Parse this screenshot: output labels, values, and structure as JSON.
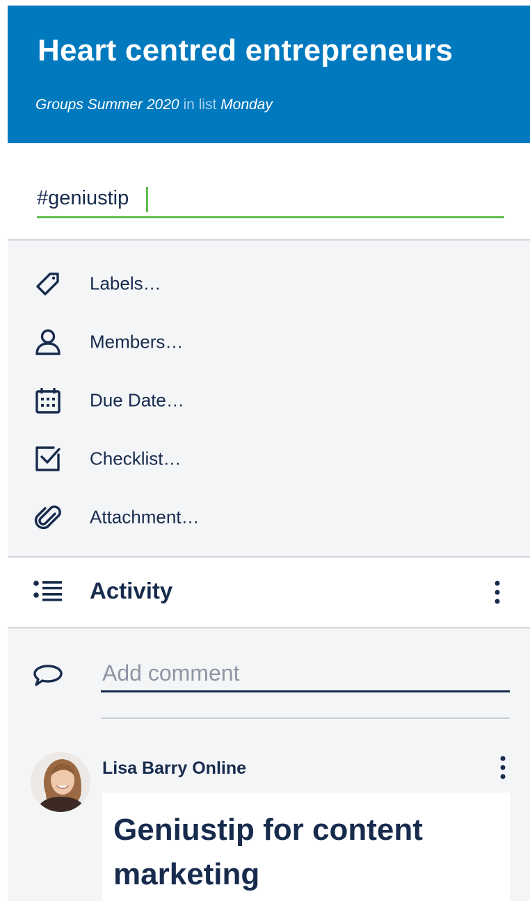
{
  "header": {
    "title": "Heart centred entrepreneurs",
    "board": "Groups Summer 2020",
    "in_list": "in list",
    "list": "Monday"
  },
  "card": {
    "name_value": "#geniustip"
  },
  "actions": [
    {
      "label": "Labels…",
      "icon": "tag-icon"
    },
    {
      "label": "Members…",
      "icon": "person-icon"
    },
    {
      "label": "Due Date…",
      "icon": "calendar-icon"
    },
    {
      "label": "Checklist…",
      "icon": "checkbox-icon"
    },
    {
      "label": "Attachment…",
      "icon": "paperclip-icon"
    }
  ],
  "activity": {
    "title": "Activity",
    "icon": "list-icon"
  },
  "comment": {
    "placeholder": "Add comment",
    "icon": "speech-bubble-icon"
  },
  "entries": [
    {
      "author": "Lisa Barry Online",
      "heading": "Geniustip for content marketing"
    }
  ],
  "colors": {
    "header_bg": "#0079bf",
    "accent_green": "#61bd4f",
    "text": "#172b4d",
    "panel_bg": "#f4f5f7"
  }
}
